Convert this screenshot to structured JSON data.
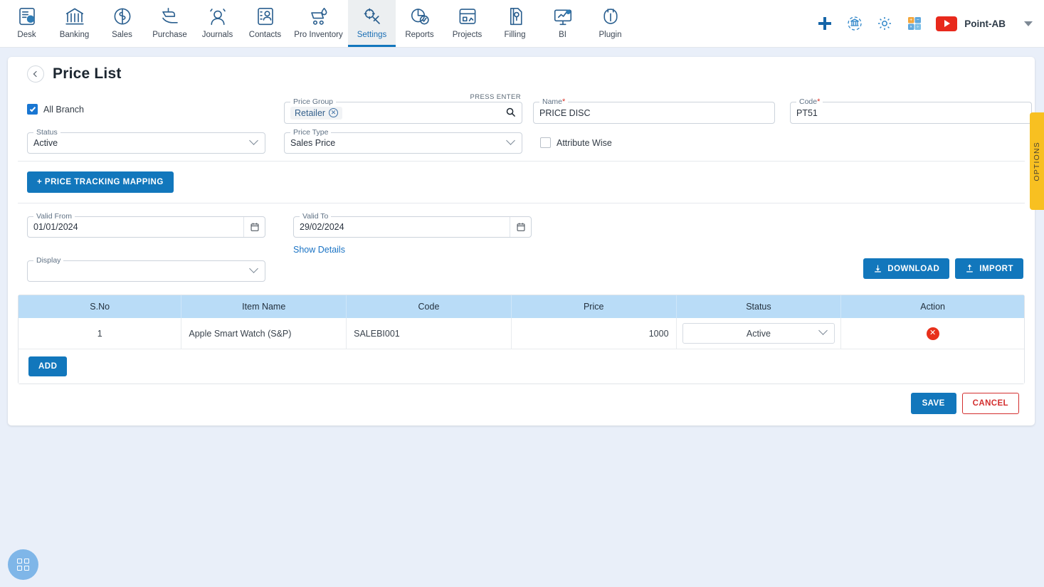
{
  "nav": {
    "items": [
      {
        "label": "Desk",
        "icon": "desk-icon",
        "active": false
      },
      {
        "label": "Banking",
        "icon": "bank-icon",
        "active": false
      },
      {
        "label": "Sales",
        "icon": "sales-icon",
        "active": false
      },
      {
        "label": "Purchase",
        "icon": "purchase-icon",
        "active": false
      },
      {
        "label": "Journals",
        "icon": "journals-icon",
        "active": false
      },
      {
        "label": "Contacts",
        "icon": "contacts-icon",
        "active": false
      },
      {
        "label": "Pro Inventory",
        "icon": "inventory-icon",
        "active": false
      },
      {
        "label": "Settings",
        "icon": "settings-icon",
        "active": true
      },
      {
        "label": "Reports",
        "icon": "reports-icon",
        "active": false
      },
      {
        "label": "Projects",
        "icon": "projects-icon",
        "active": false
      },
      {
        "label": "Filling",
        "icon": "filling-icon",
        "active": false
      },
      {
        "label": "BI",
        "icon": "bi-icon",
        "active": false
      },
      {
        "label": "Plugin",
        "icon": "plugin-icon",
        "active": false
      }
    ],
    "right": {
      "add_icon": "plus-icon",
      "refresh_icon": "bank-refresh-icon",
      "settings_icon": "gear-icon",
      "calculator_icon": "calculator-icon",
      "youtube_icon": "youtube-icon",
      "company": "Point-AB",
      "chevron_icon": "chevron-down-icon"
    }
  },
  "page": {
    "back_icon": "chevron-left-icon",
    "title": "Price List"
  },
  "form": {
    "all_branch": {
      "label": "All Branch",
      "checked": true
    },
    "price_group": {
      "label": "Price Group",
      "hint": "PRESS ENTER",
      "chips": [
        "Retailer"
      ],
      "search_icon": "search-icon"
    },
    "name": {
      "label": "Name",
      "required": "*",
      "value": "PRICE DISC"
    },
    "code": {
      "label": "Code",
      "required": "*",
      "value": "PT51"
    },
    "status": {
      "label": "Status",
      "value": "Active"
    },
    "price_type": {
      "label": "Price Type",
      "value": "Sales Price"
    },
    "attribute_wise": {
      "label": "Attribute Wise",
      "checked": false
    },
    "price_tracking_mapping_button": "+ PRICE TRACKING MAPPING",
    "valid_from": {
      "label": "Valid From",
      "value": "01/01/2024",
      "icon": "calendar-icon"
    },
    "valid_to": {
      "label": "Valid To",
      "value": "29/02/2024",
      "icon": "calendar-icon"
    },
    "show_details_link": "Show Details",
    "display": {
      "label": "Display",
      "value": ""
    }
  },
  "toolbar": {
    "download_label": "DOWNLOAD",
    "download_icon": "download-icon",
    "import_label": "IMPORT",
    "import_icon": "upload-icon"
  },
  "table": {
    "columns": [
      "S.No",
      "Item Name",
      "Code",
      "Price",
      "Status",
      "Action"
    ],
    "rows": [
      {
        "sno": "1",
        "item_name": "Apple Smart Watch (S&P)",
        "code": "SALEBI001",
        "price": "1000",
        "status": "Active",
        "action_icon": "delete-icon"
      }
    ],
    "add_label": "ADD"
  },
  "footer": {
    "save_label": "SAVE",
    "cancel_label": "CANCEL"
  },
  "options_tab": {
    "label": "OPTIONS"
  },
  "fab": {
    "icon": "apps-grid-icon"
  },
  "colors": {
    "primary": "#1277bc",
    "table_header": "#b9dcf7",
    "danger": "#d32f2f",
    "delete": "#e8301b",
    "options_tab": "#f8c021",
    "page_bg": "#e9eff9"
  }
}
